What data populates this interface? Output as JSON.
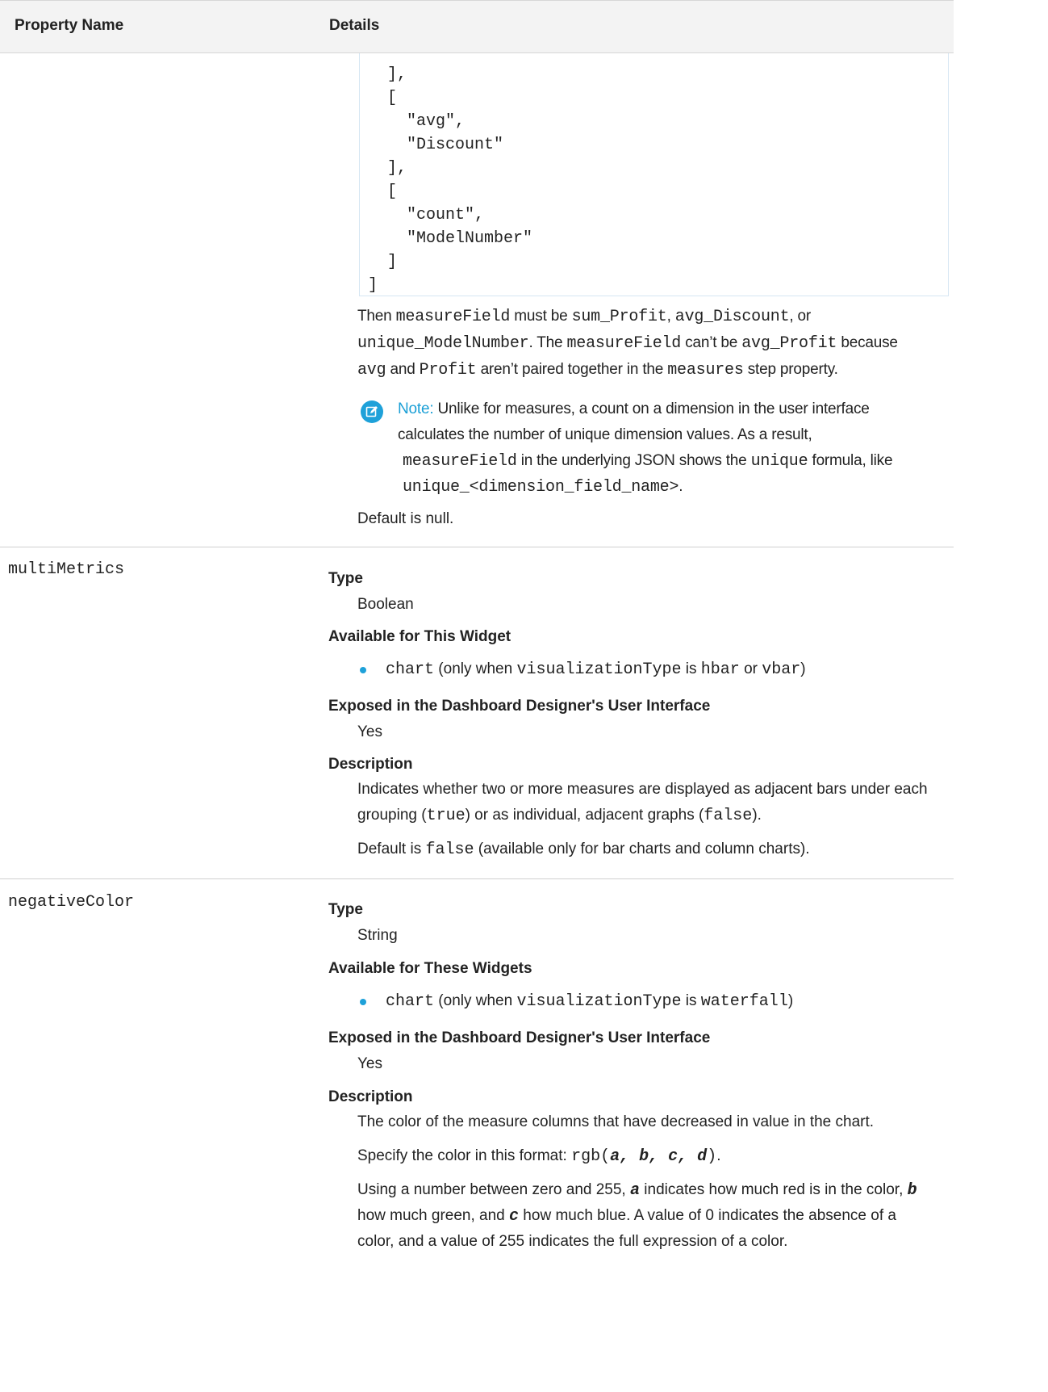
{
  "header": {
    "col_property": "Property Name",
    "col_details": "Details"
  },
  "code_lines": [
    "  ],",
    "  [",
    "    \"avg\",",
    "    \"Discount\"",
    "  ],",
    "  [",
    "    \"count\",",
    "    \"ModelNumber\"",
    "  ]",
    "]"
  ],
  "measure_paragraph": {
    "l1_a": "Then ",
    "l1_code1": "measureField",
    "l1_b": " must be ",
    "l1_code2": "sum_Profit",
    "l1_c": ", ",
    "l1_code3": "avg_Discount",
    "l1_d": ", or",
    "l2_code1": "unique_ModelNumber",
    "l2_a": ". The ",
    "l2_code2": "measureField",
    "l2_b": " can’t be ",
    "l2_code3": "avg_Profit",
    "l2_c": " because",
    "l3_code1": "avg",
    "l3_a": " and ",
    "l3_code2": "Profit",
    "l3_b": " aren’t paired together in the ",
    "l3_code3": "measures",
    "l3_c": " step property."
  },
  "note": {
    "label": "Note:",
    "l1": " Unlike for measures, a count on a dimension in the user interface",
    "l2": "calculates the number of unique dimension values. As a result,",
    "l3_code1": "measureField",
    "l3_a": " in the underlying JSON shows the ",
    "l3_code2": "unique",
    "l3_b": " formula, like",
    "l4_code": "unique_<dimension_field_name>",
    "l4_a": "."
  },
  "default_null": "Default is null.",
  "rows": [
    {
      "name": "multiMetrics",
      "type_label": "Type",
      "type_value": "Boolean",
      "avail_label": "Available for This Widget",
      "avail_code1": "chart",
      "avail_a": " (only when ",
      "avail_code2": "visualizationType",
      "avail_b": " is ",
      "avail_code3": "hbar",
      "avail_c": " or ",
      "avail_code4": "vbar",
      "avail_d": ")",
      "exposed_label": "Exposed in the Dashboard Designer's User Interface",
      "exposed_value": "Yes",
      "desc_label": "Description",
      "desc_l1": "Indicates whether two or more measures are displayed as adjacent bars under each",
      "desc_l2_a": "grouping (",
      "desc_l2_code1": "true",
      "desc_l2_b": ") or as individual, adjacent graphs (",
      "desc_l2_code2": "false",
      "desc_l2_c": ").",
      "default_a": "Default is ",
      "default_code": "false",
      "default_b": " (available only for bar charts and column charts)."
    },
    {
      "name": "negativeColor",
      "type_label": "Type",
      "type_value": "String",
      "avail_label": "Available for These Widgets",
      "avail_code1": "chart",
      "avail_a": " (only when ",
      "avail_code2": "visualizationType",
      "avail_b": " is ",
      "avail_code3": "waterfall",
      "avail_c": ")",
      "exposed_label": "Exposed in the Dashboard Designer's User Interface",
      "exposed_value": "Yes",
      "desc_label": "Description",
      "desc_l1": "The color of the measure columns that have decreased in value in the chart.",
      "fmt_a": "Specify the color in this format: ",
      "fmt_code1": "rgb(",
      "fmt_a_var": "a",
      "fmt_sep1": ", ",
      "fmt_b_var": "b",
      "fmt_sep2": ", ",
      "fmt_c_var": "c",
      "fmt_sep3": ", ",
      "fmt_d_var": "d",
      "fmt_code2": ")",
      "fmt_end": ".",
      "use_l1_a": "Using a number between zero and 255, ",
      "use_l1_var_a": "a",
      "use_l1_b": " indicates how much red is in the color, ",
      "use_l1_var_b": "b",
      "use_l2_a": "how much green, and ",
      "use_l2_var_c": "c",
      "use_l2_b": " how much blue. A value of 0 indicates the absence of a",
      "use_l3": "color, and a value of 255 indicates the full expression of a color."
    }
  ],
  "colors": {
    "accent": "#1ea1d9",
    "header_bg": "#f3f3f3",
    "border": "#d0d0d0"
  },
  "icons": {
    "note": "edit-pencil-icon",
    "bullet": "bullet-dot-icon"
  }
}
